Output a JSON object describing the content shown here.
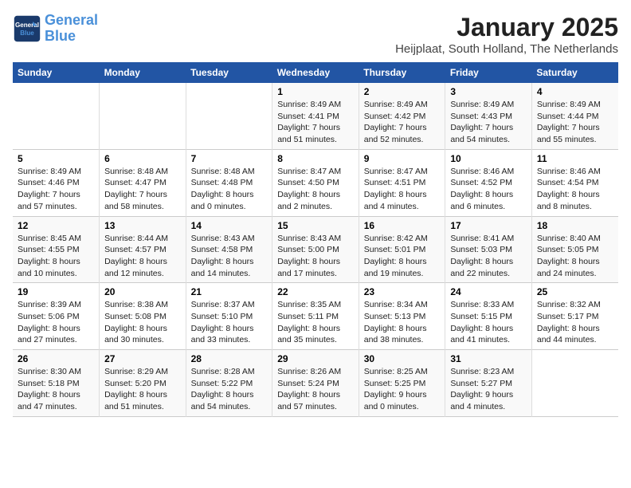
{
  "header": {
    "logo_line1": "General",
    "logo_line2": "Blue",
    "month": "January 2025",
    "location": "Heijplaat, South Holland, The Netherlands"
  },
  "days_of_week": [
    "Sunday",
    "Monday",
    "Tuesday",
    "Wednesday",
    "Thursday",
    "Friday",
    "Saturday"
  ],
  "weeks": [
    [
      {
        "day": "",
        "content": ""
      },
      {
        "day": "",
        "content": ""
      },
      {
        "day": "",
        "content": ""
      },
      {
        "day": "1",
        "content": "Sunrise: 8:49 AM\nSunset: 4:41 PM\nDaylight: 7 hours and 51 minutes."
      },
      {
        "day": "2",
        "content": "Sunrise: 8:49 AM\nSunset: 4:42 PM\nDaylight: 7 hours and 52 minutes."
      },
      {
        "day": "3",
        "content": "Sunrise: 8:49 AM\nSunset: 4:43 PM\nDaylight: 7 hours and 54 minutes."
      },
      {
        "day": "4",
        "content": "Sunrise: 8:49 AM\nSunset: 4:44 PM\nDaylight: 7 hours and 55 minutes."
      }
    ],
    [
      {
        "day": "5",
        "content": "Sunrise: 8:49 AM\nSunset: 4:46 PM\nDaylight: 7 hours and 57 minutes."
      },
      {
        "day": "6",
        "content": "Sunrise: 8:48 AM\nSunset: 4:47 PM\nDaylight: 7 hours and 58 minutes."
      },
      {
        "day": "7",
        "content": "Sunrise: 8:48 AM\nSunset: 4:48 PM\nDaylight: 8 hours and 0 minutes."
      },
      {
        "day": "8",
        "content": "Sunrise: 8:47 AM\nSunset: 4:50 PM\nDaylight: 8 hours and 2 minutes."
      },
      {
        "day": "9",
        "content": "Sunrise: 8:47 AM\nSunset: 4:51 PM\nDaylight: 8 hours and 4 minutes."
      },
      {
        "day": "10",
        "content": "Sunrise: 8:46 AM\nSunset: 4:52 PM\nDaylight: 8 hours and 6 minutes."
      },
      {
        "day": "11",
        "content": "Sunrise: 8:46 AM\nSunset: 4:54 PM\nDaylight: 8 hours and 8 minutes."
      }
    ],
    [
      {
        "day": "12",
        "content": "Sunrise: 8:45 AM\nSunset: 4:55 PM\nDaylight: 8 hours and 10 minutes."
      },
      {
        "day": "13",
        "content": "Sunrise: 8:44 AM\nSunset: 4:57 PM\nDaylight: 8 hours and 12 minutes."
      },
      {
        "day": "14",
        "content": "Sunrise: 8:43 AM\nSunset: 4:58 PM\nDaylight: 8 hours and 14 minutes."
      },
      {
        "day": "15",
        "content": "Sunrise: 8:43 AM\nSunset: 5:00 PM\nDaylight: 8 hours and 17 minutes."
      },
      {
        "day": "16",
        "content": "Sunrise: 8:42 AM\nSunset: 5:01 PM\nDaylight: 8 hours and 19 minutes."
      },
      {
        "day": "17",
        "content": "Sunrise: 8:41 AM\nSunset: 5:03 PM\nDaylight: 8 hours and 22 minutes."
      },
      {
        "day": "18",
        "content": "Sunrise: 8:40 AM\nSunset: 5:05 PM\nDaylight: 8 hours and 24 minutes."
      }
    ],
    [
      {
        "day": "19",
        "content": "Sunrise: 8:39 AM\nSunset: 5:06 PM\nDaylight: 8 hours and 27 minutes."
      },
      {
        "day": "20",
        "content": "Sunrise: 8:38 AM\nSunset: 5:08 PM\nDaylight: 8 hours and 30 minutes."
      },
      {
        "day": "21",
        "content": "Sunrise: 8:37 AM\nSunset: 5:10 PM\nDaylight: 8 hours and 33 minutes."
      },
      {
        "day": "22",
        "content": "Sunrise: 8:35 AM\nSunset: 5:11 PM\nDaylight: 8 hours and 35 minutes."
      },
      {
        "day": "23",
        "content": "Sunrise: 8:34 AM\nSunset: 5:13 PM\nDaylight: 8 hours and 38 minutes."
      },
      {
        "day": "24",
        "content": "Sunrise: 8:33 AM\nSunset: 5:15 PM\nDaylight: 8 hours and 41 minutes."
      },
      {
        "day": "25",
        "content": "Sunrise: 8:32 AM\nSunset: 5:17 PM\nDaylight: 8 hours and 44 minutes."
      }
    ],
    [
      {
        "day": "26",
        "content": "Sunrise: 8:30 AM\nSunset: 5:18 PM\nDaylight: 8 hours and 47 minutes."
      },
      {
        "day": "27",
        "content": "Sunrise: 8:29 AM\nSunset: 5:20 PM\nDaylight: 8 hours and 51 minutes."
      },
      {
        "day": "28",
        "content": "Sunrise: 8:28 AM\nSunset: 5:22 PM\nDaylight: 8 hours and 54 minutes."
      },
      {
        "day": "29",
        "content": "Sunrise: 8:26 AM\nSunset: 5:24 PM\nDaylight: 8 hours and 57 minutes."
      },
      {
        "day": "30",
        "content": "Sunrise: 8:25 AM\nSunset: 5:25 PM\nDaylight: 9 hours and 0 minutes."
      },
      {
        "day": "31",
        "content": "Sunrise: 8:23 AM\nSunset: 5:27 PM\nDaylight: 9 hours and 4 minutes."
      },
      {
        "day": "",
        "content": ""
      }
    ]
  ]
}
